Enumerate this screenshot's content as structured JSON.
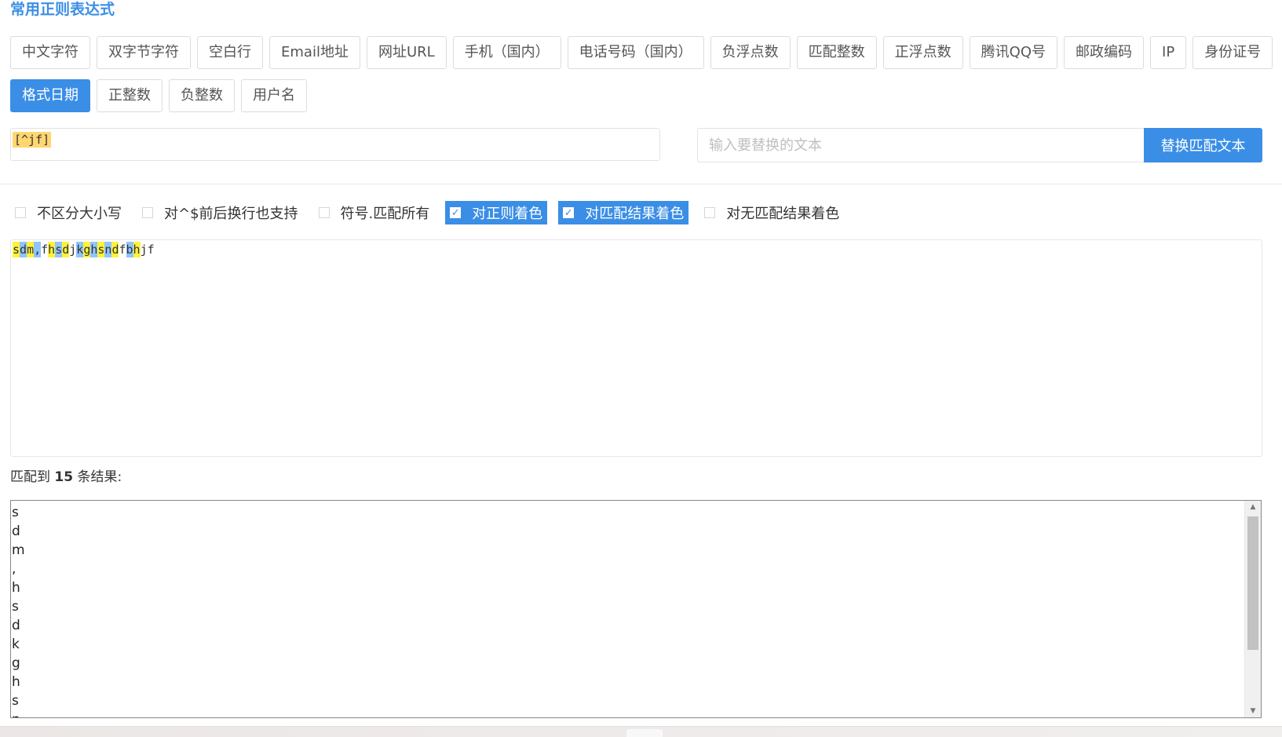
{
  "title": "常用正则表达式",
  "presets_row1": [
    {
      "label": "中文字符",
      "active": false
    },
    {
      "label": "双字节字符",
      "active": false
    },
    {
      "label": "空白行",
      "active": false
    },
    {
      "label": "Email地址",
      "active": false
    },
    {
      "label": "网址URL",
      "active": false
    },
    {
      "label": "手机（国内）",
      "active": false
    },
    {
      "label": "电话号码（国内）",
      "active": false
    },
    {
      "label": "负浮点数",
      "active": false
    },
    {
      "label": "匹配整数",
      "active": false
    },
    {
      "label": "正浮点数",
      "active": false
    },
    {
      "label": "腾讯QQ号",
      "active": false
    },
    {
      "label": "邮政编码",
      "active": false
    },
    {
      "label": "IP",
      "active": false
    },
    {
      "label": "身份证号",
      "active": false
    }
  ],
  "presets_row2": [
    {
      "label": "格式日期",
      "active": true
    },
    {
      "label": "正整数",
      "active": false
    },
    {
      "label": "负整数",
      "active": false
    },
    {
      "label": "用户名",
      "active": false
    }
  ],
  "regex": {
    "value": "[^jf]"
  },
  "replace": {
    "placeholder": "输入要替换的文本",
    "button_label": "替换匹配文本"
  },
  "options": [
    {
      "label": "不区分大小写",
      "checked": false
    },
    {
      "label": "对^$前后换行也支持",
      "checked": false
    },
    {
      "label": "符号.匹配所有",
      "checked": false
    },
    {
      "label": "对正则着色",
      "checked": true
    },
    {
      "label": "对匹配结果着色",
      "checked": true
    },
    {
      "label": "对无匹配结果着色",
      "checked": false
    }
  ],
  "test_text": {
    "value": "sdm,fhsdjkghsndfbhjf",
    "segments": [
      {
        "text": "s",
        "color": "#fff23a"
      },
      {
        "text": "d",
        "color": "#8ec5ff"
      },
      {
        "text": "m",
        "color": "#fff23a"
      },
      {
        "text": ",",
        "color": "#8ec5ff"
      },
      {
        "text": "f",
        "color": ""
      },
      {
        "text": "h",
        "color": "#fff23a"
      },
      {
        "text": "s",
        "color": "#8ec5ff"
      },
      {
        "text": "d",
        "color": "#fff23a"
      },
      {
        "text": "j",
        "color": ""
      },
      {
        "text": "k",
        "color": "#8ec5ff"
      },
      {
        "text": "g",
        "color": "#fff23a"
      },
      {
        "text": "h",
        "color": "#8ec5ff"
      },
      {
        "text": "s",
        "color": "#fff23a"
      },
      {
        "text": "n",
        "color": "#8ec5ff"
      },
      {
        "text": "d",
        "color": "#fff23a"
      },
      {
        "text": "f",
        "color": ""
      },
      {
        "text": "b",
        "color": "#8ec5ff"
      },
      {
        "text": "h",
        "color": "#fff23a"
      },
      {
        "text": "j",
        "color": ""
      },
      {
        "text": "f",
        "color": ""
      }
    ]
  },
  "summary": {
    "prefix": "匹配到 ",
    "count": "15",
    "suffix": " 条结果:"
  },
  "results": [
    "s",
    "d",
    "m",
    ",",
    "h",
    "s",
    "d",
    "k",
    "g",
    "h",
    "s",
    "n"
  ],
  "colors": {
    "accent": "#3a8ee6",
    "match_a": "#fff23a",
    "match_b": "#8ec5ff",
    "regex_highlight": "#ffd670"
  }
}
